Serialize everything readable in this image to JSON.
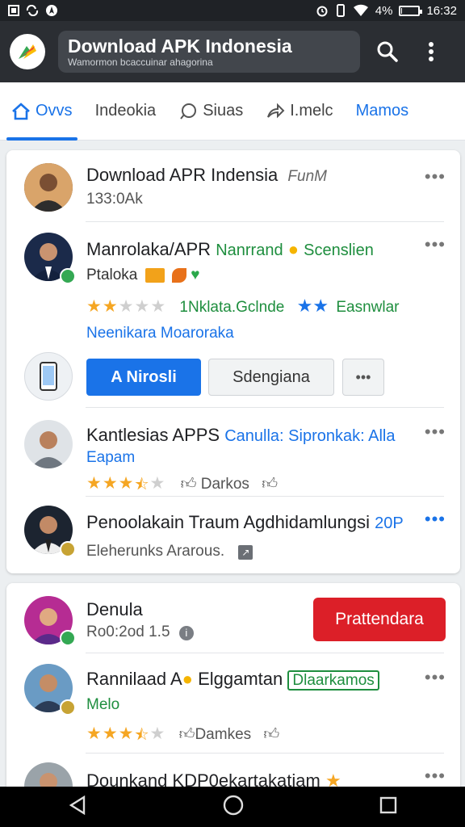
{
  "status_bar": {
    "left_icons": [
      "image-icon",
      "sync-icon",
      "navigation-icon"
    ],
    "battery_text": "4%",
    "time": "16:32",
    "battery_level": 0.04
  },
  "app_bar": {
    "title": "Download APK Indonesia",
    "subtitle": "Wamormon bcaccuinar ahagorina"
  },
  "tabs": [
    {
      "label": "Ovvs",
      "icon": "home-icon"
    },
    {
      "label": "Indeokia",
      "icon": ""
    },
    {
      "label": "Siuas",
      "icon": "chat-icon"
    },
    {
      "label": "I.melc",
      "icon": "share-icon"
    },
    {
      "label": "Mamos",
      "icon": ""
    }
  ],
  "card1": {
    "item1": {
      "title": "Download APR Indensia",
      "title_extra": "FunM",
      "sub": "133:0Ak"
    },
    "item2": {
      "title": "Manrolaka/APR",
      "title_green": "Nanrrand",
      "title_green2": "Scenslien",
      "line2": "Ptaloka",
      "rating_main": 2,
      "rating_text": "1Nklata.Gclnde",
      "rating_text2": "Easnwlar",
      "line4": "Neenikara  Moaroraka",
      "btn_primary": "A Nirosli",
      "btn_secondary": "Sdengiana",
      "btn_more": "•••"
    },
    "item3": {
      "title": "Kantlesias APPS",
      "title_blue": "Canulla: Sipronkak: Alla",
      "line2": "Eapam",
      "rating": 3.5,
      "like_label": "Darkos"
    },
    "item4": {
      "title": "Penoolakain Traum Agdhidamlungsi",
      "title_blue": "20P",
      "line2": "Eleherunks Ararous."
    }
  },
  "card2": {
    "item1": {
      "title": "Denula",
      "sub": "Ro0:2od 1.5",
      "btn": "Prattendara"
    },
    "item2": {
      "title": "Rannilaad A",
      "title2": "Elggamtan",
      "chip": "Dlaarkamos",
      "line2": "Melo",
      "rating": 3.5,
      "like_label": "Damkes"
    },
    "item3": {
      "title": "Dounkand KDP0ekartakatiam"
    }
  },
  "colors": {
    "accent": "#1a73e8",
    "red": "#dc1f28",
    "green": "#1e8e3e",
    "star": "#f5a623"
  }
}
